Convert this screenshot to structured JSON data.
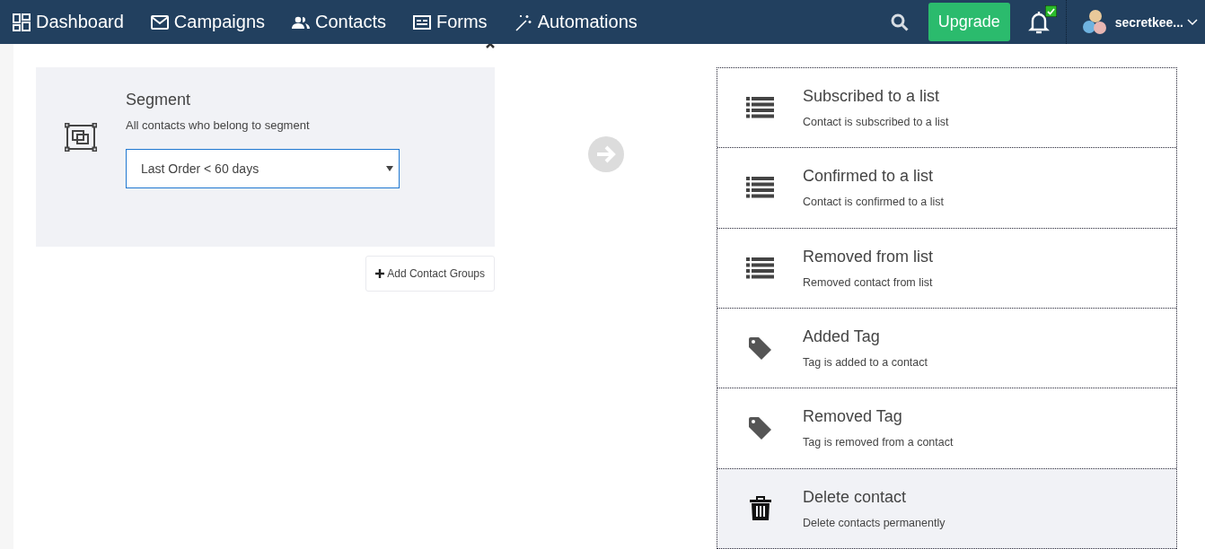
{
  "nav": {
    "items": [
      {
        "label": "Dashboard",
        "kind": "dashboard"
      },
      {
        "label": "Campaigns",
        "kind": "mail"
      },
      {
        "label": "Contacts",
        "kind": "people"
      },
      {
        "label": "Forms",
        "kind": "form"
      },
      {
        "label": "Automations",
        "kind": "wand"
      }
    ],
    "upgrade": "Upgrade",
    "notification_badge": true,
    "user": "secretkee..."
  },
  "segment": {
    "title": "Segment",
    "description": "All contacts who belong to segment",
    "value": "Last Order < 60 days",
    "add_button": "Add Contact Groups"
  },
  "triggers": [
    {
      "kind": "list",
      "title": "Subscribed to a list",
      "description": "Contact is subscribed to a list",
      "selected": false
    },
    {
      "kind": "list",
      "title": "Confirmed to a list",
      "description": "Contact is confirmed to a list",
      "selected": false
    },
    {
      "kind": "list",
      "title": "Removed from list",
      "description": "Removed contact from list",
      "selected": false
    },
    {
      "kind": "tag",
      "title": "Added Tag",
      "description": "Tag is added to a contact",
      "selected": false
    },
    {
      "kind": "tag",
      "title": "Removed Tag",
      "description": "Tag is removed from a contact",
      "selected": false
    },
    {
      "kind": "trash",
      "title": "Delete contact",
      "description": "Delete contacts permanently",
      "selected": true
    }
  ]
}
